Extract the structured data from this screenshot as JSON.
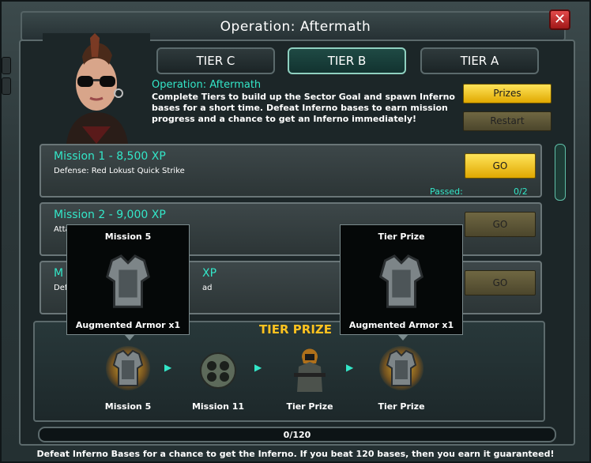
{
  "window": {
    "title": "Operation: Aftermath",
    "close_label": "✕"
  },
  "tabs": [
    {
      "label": "TIER C",
      "active": false
    },
    {
      "label": "TIER B",
      "active": true
    },
    {
      "label": "TIER A",
      "active": false
    }
  ],
  "operation": {
    "name": "Operation: Aftermath",
    "description": "Complete Tiers to build up the Sector Goal and spawn Inferno bases for a short time. Defeat Inferno bases to earn mission progress and a chance to get an Inferno immediately!",
    "prizes_label": "Prizes",
    "restart_label": "Restart"
  },
  "missions": [
    {
      "title": "Mission 1 - 8,500 XP",
      "subtitle": "Defense: Red Lokust Quick Strike",
      "go_label": "GO",
      "passed_label": "Passed:",
      "passed_value": "0/2"
    },
    {
      "title": "Mission 2 - 9,000 XP",
      "subtitle": "Atta",
      "go_label": "GO"
    },
    {
      "title": "M",
      "title_tail": "XP",
      "subtitle": "Defe",
      "subtitle_tail": "ad",
      "go_label": "GO"
    }
  ],
  "tooltips": [
    {
      "title": "Mission 5",
      "reward": "Augmented Armor x1"
    },
    {
      "title": "Tier Prize",
      "reward": "Augmented Armor x1"
    }
  ],
  "tier_prizes": {
    "title": "TIER PRIZE",
    "items": [
      {
        "label": "Mission 5",
        "icon": "armor-icon"
      },
      {
        "label": "Mission 11",
        "icon": "turret-icon"
      },
      {
        "label": "Tier Prize",
        "icon": "soldier-icon"
      },
      {
        "label": "Tier Prize",
        "icon": "armor-icon"
      }
    ]
  },
  "progress": {
    "text": "0/120",
    "value": 0,
    "max": 120
  },
  "footer": "Defeat Inferno Bases for a chance to get the Inferno. If you beat 120 bases, then you earn it guaranteed!",
  "colors": {
    "accent": "#33e6c8",
    "gold": "#ffc21f",
    "button": "#f5c400",
    "close": "#c42020"
  }
}
